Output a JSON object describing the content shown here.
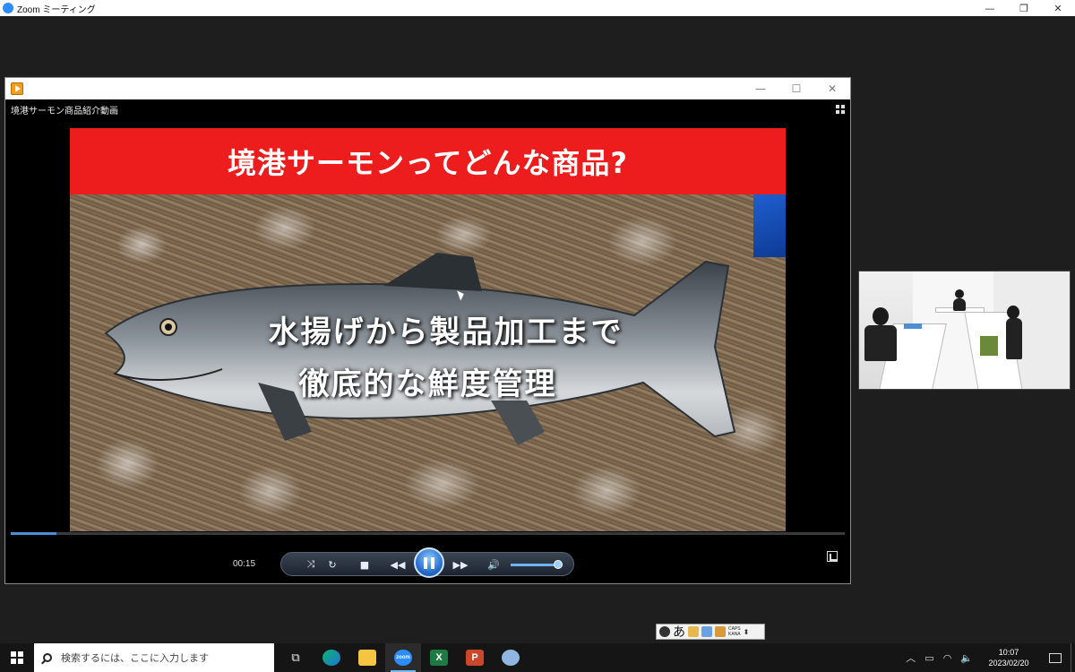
{
  "zoom": {
    "title": "Zoom ミーティング"
  },
  "player": {
    "video_title": "境港サーモン商品紹介動画",
    "banner": "境港サーモンってどんな商品?",
    "overlay_line1": "水揚げから製品加工まで",
    "overlay_line2": "徹底的な鮮度管理",
    "time": "00:15",
    "progress": 0.055,
    "volume": 0.92
  },
  "ime": {
    "mode_char": "あ",
    "caps_line1": "CAPS",
    "caps_line2": "KANA"
  },
  "taskbar": {
    "search_placeholder": "検索するには、ここに入力します",
    "apps": [
      "task-view",
      "edge",
      "file-explorer",
      "zoom",
      "excel",
      "powerpoint",
      "paint"
    ],
    "clock_time": "10:07",
    "clock_date": "2023/02/20"
  },
  "colors": {
    "banner_red": "#ee1d1d",
    "zoom_blue": "#2d8cff",
    "seek_blue": "#4a90d9"
  }
}
